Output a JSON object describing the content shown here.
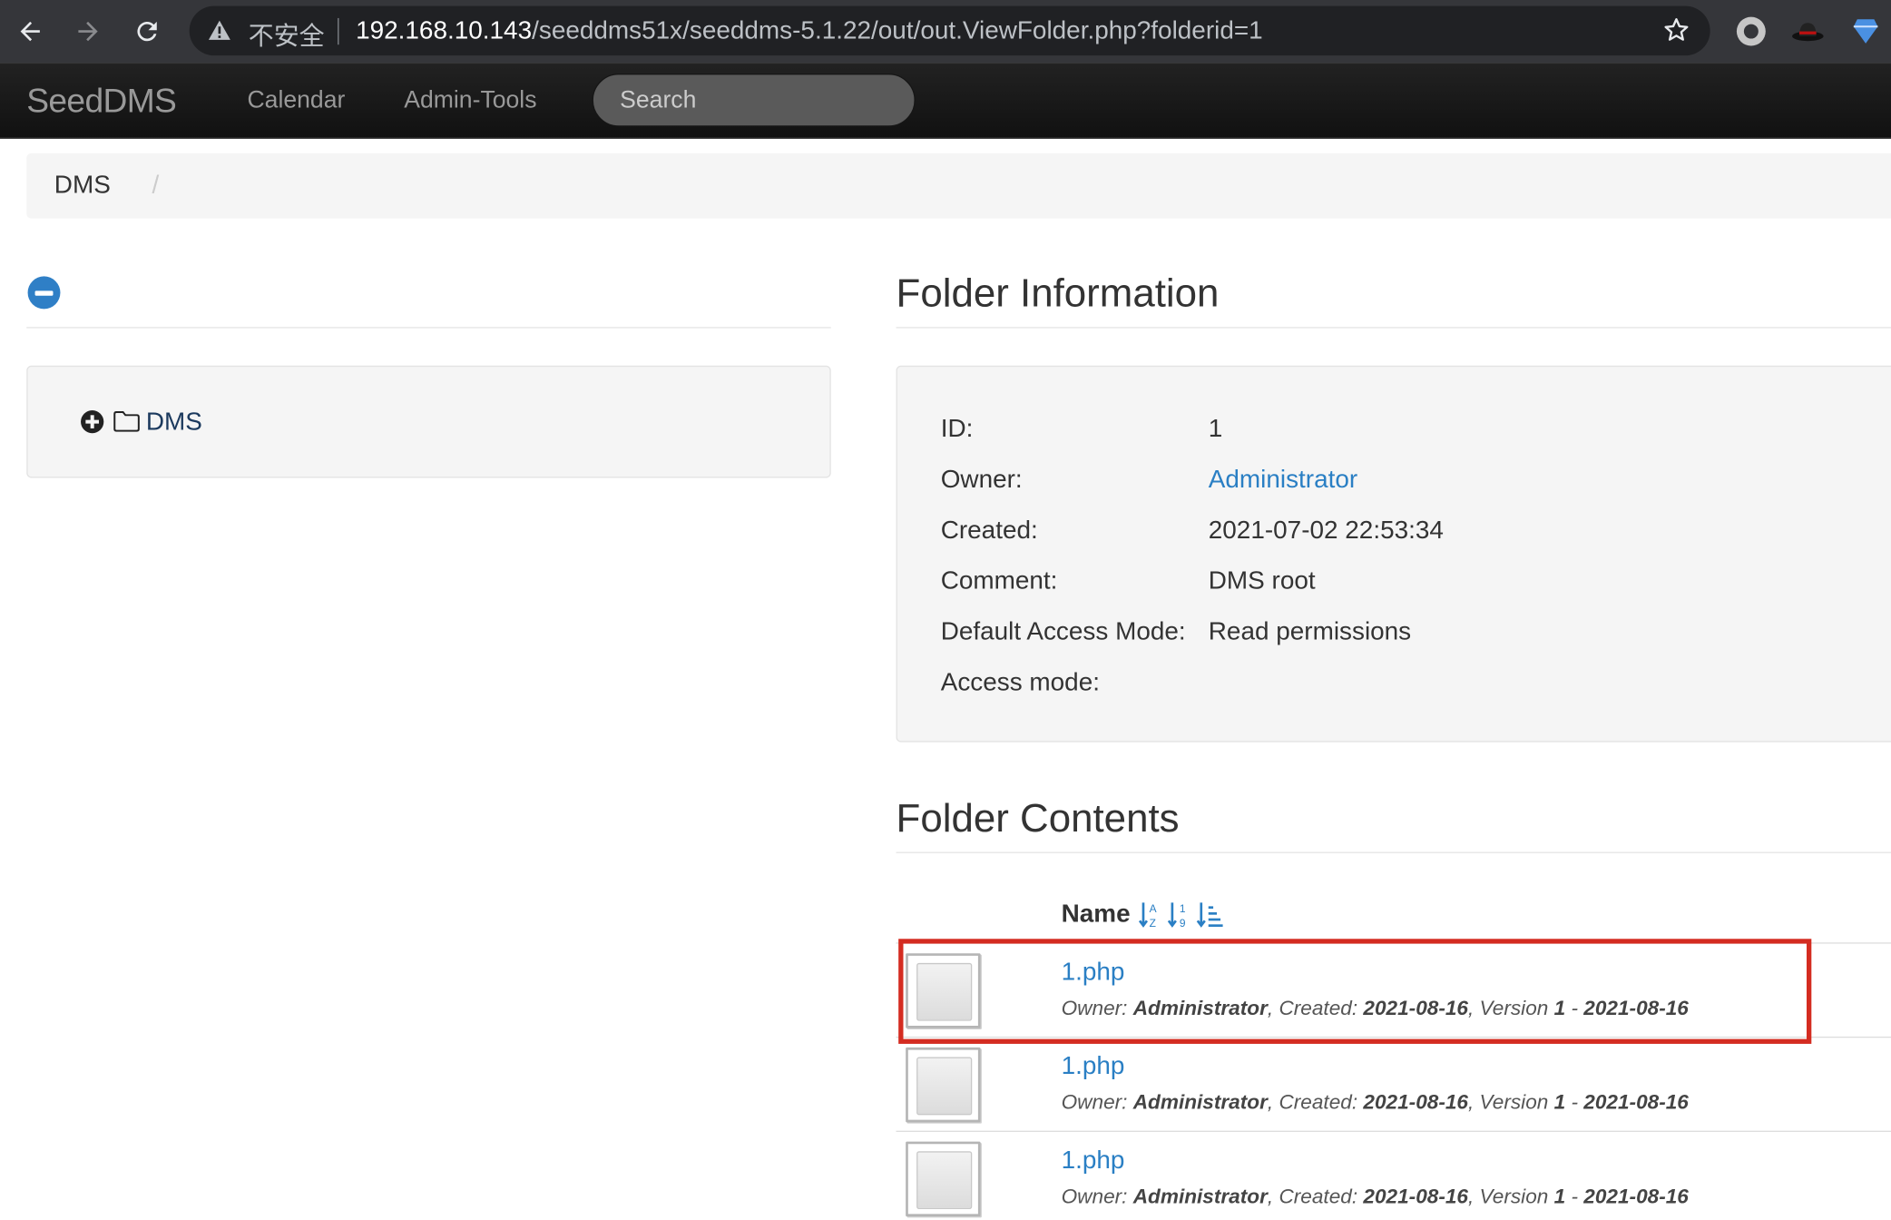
{
  "browser": {
    "insecure_label": "不安全",
    "url_host": "192.168.10.143",
    "url_path": "/seeddms51x/seeddms-5.1.22/out/out.ViewFolder.php?folderid=1"
  },
  "navbar": {
    "brand": "SeedDMS",
    "links": [
      "Calendar",
      "Admin-Tools"
    ],
    "search_placeholder": "Search"
  },
  "breadcrumb": {
    "items": [
      "DMS"
    ],
    "divider": "/"
  },
  "tree": {
    "root_label": "DMS"
  },
  "folder_info": {
    "title": "Folder Information",
    "rows": [
      {
        "label": "ID:",
        "value": "1"
      },
      {
        "label": "Owner:",
        "value": "Administrator"
      },
      {
        "label": "Created:",
        "value": "2021-07-02 22:53:34"
      },
      {
        "label": "Comment:",
        "value": "DMS root"
      },
      {
        "label": "Default Access Mode:",
        "value": "Read permissions"
      },
      {
        "label": "Access mode:",
        "value": ""
      }
    ]
  },
  "folder_contents": {
    "title": "Folder Contents",
    "column_name": "Name",
    "documents": [
      {
        "name": "1.php",
        "owner_label": "Owner:",
        "owner": "Administrator",
        "created_label": "Created:",
        "created": "2021-08-16",
        "version_label": "Version",
        "version": "1",
        "version_date": "2021-08-16"
      },
      {
        "name": "1.php",
        "owner_label": "Owner:",
        "owner": "Administrator",
        "created_label": "Created:",
        "created": "2021-08-16",
        "version_label": "Version",
        "version": "1",
        "version_date": "2021-08-16"
      },
      {
        "name": "1.php",
        "owner_label": "Owner:",
        "owner": "Administrator",
        "created_label": "Created:",
        "created": "2021-08-16",
        "version_label": "Version",
        "version": "1",
        "version_date": "2021-08-16"
      }
    ]
  },
  "colors": {
    "link": "#2a7fc4",
    "navbar_bg": "#1b1b1b",
    "highlight": "#d42c21"
  }
}
